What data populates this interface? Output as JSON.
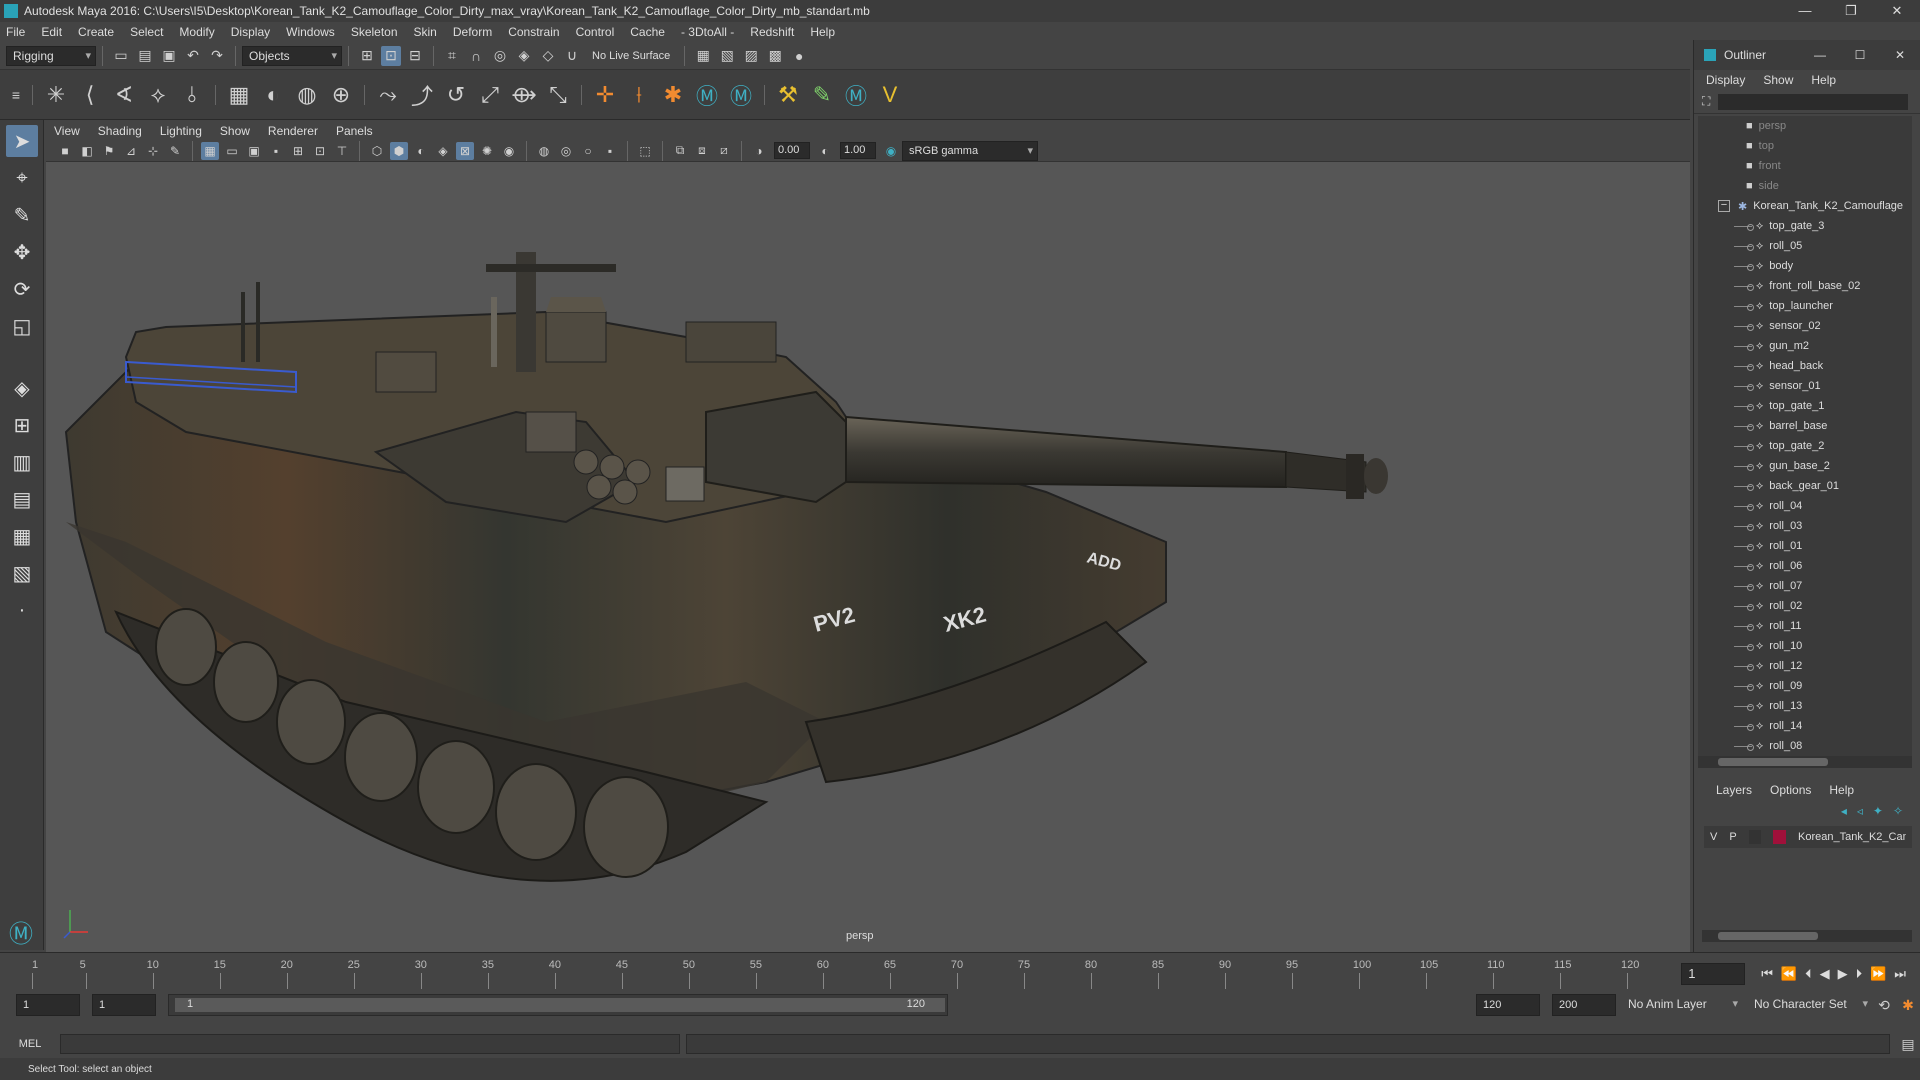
{
  "window": {
    "title": "Autodesk Maya 2016: C:\\Users\\I5\\Desktop\\Korean_Tank_K2_Camouflage_Color_Dirty_max_vray\\Korean_Tank_K2_Camouflage_Color_Dirty_mb_standart.mb",
    "controls": [
      "—",
      "❐",
      "✕"
    ]
  },
  "menubar": [
    "File",
    "Edit",
    "Create",
    "Select",
    "Modify",
    "Display",
    "Windows",
    "Skeleton",
    "Skin",
    "Deform",
    "Constrain",
    "Control",
    "Cache",
    "- 3DtoAll -",
    "Redshift",
    "Help"
  ],
  "statusline": {
    "mode": "Rigging",
    "selection_mode": "Objects",
    "live_surface": "No Live Surface"
  },
  "panel_menu": [
    "View",
    "Shading",
    "Lighting",
    "Show",
    "Renderer",
    "Panels"
  ],
  "panel_tools": {
    "exposure": "0.00",
    "gamma": "1.00",
    "color_space": "sRGB gamma"
  },
  "viewport": {
    "camera_label": "persp"
  },
  "outliner": {
    "title": "Outliner",
    "menu": [
      "Display",
      "Show",
      "Help"
    ],
    "cameras": [
      "persp",
      "top",
      "front",
      "side"
    ],
    "group": "Korean_Tank_K2_Camouflage",
    "children": [
      "top_gate_3",
      "roll_05",
      "body",
      "front_roll_base_02",
      "top_launcher",
      "sensor_02",
      "gun_m2",
      "head_back",
      "sensor_01",
      "top_gate_1",
      "barrel_base",
      "top_gate_2",
      "gun_base_2",
      "back_gear_01",
      "roll_04",
      "roll_03",
      "roll_01",
      "roll_06",
      "roll_07",
      "roll_02",
      "roll_11",
      "roll_10",
      "roll_12",
      "roll_09",
      "roll_13",
      "roll_14",
      "roll_08"
    ]
  },
  "layers": {
    "menu": [
      "Layers",
      "Options",
      "Help"
    ],
    "row": {
      "v": "V",
      "p": "P",
      "name": "Korean_Tank_K2_Camc",
      "color": "#a0103a"
    }
  },
  "timeline": {
    "ticks": [
      "1",
      "5",
      "10",
      "15",
      "20",
      "25",
      "30",
      "35",
      "40",
      "45",
      "50",
      "55",
      "60",
      "65",
      "70",
      "75",
      "80",
      "85",
      "90",
      "95",
      "100",
      "105",
      "110",
      "115",
      "120"
    ],
    "current_frame": "1"
  },
  "range": {
    "start": "1",
    "playback_start": "1",
    "slider_start": "1",
    "slider_end": "120",
    "playback_end": "120",
    "end": "200",
    "anim_layer": "No Anim Layer",
    "character_set": "No Character Set"
  },
  "command": {
    "label": "MEL"
  },
  "status": {
    "help": "Select Tool: select an object"
  },
  "tank_markings": [
    "PV2",
    "XK2",
    "ADD"
  ]
}
